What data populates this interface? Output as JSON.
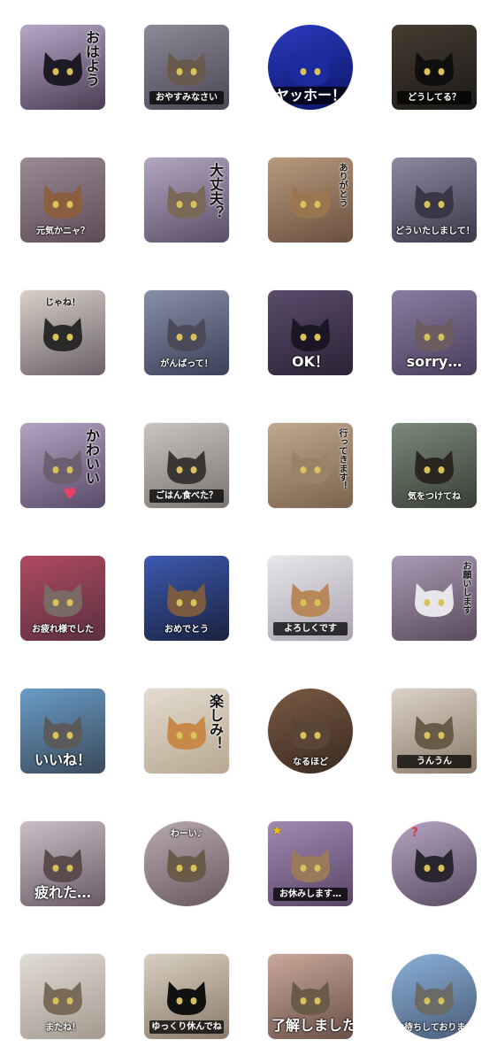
{
  "stickers": [
    {
      "id": "s01",
      "caption": "おはよう",
      "style": "vertical large black",
      "shape": "square",
      "bg": [
        "#b8a6c8",
        "#4a3d52"
      ],
      "cat": "#1d1a24",
      "deco": ""
    },
    {
      "id": "s02",
      "caption": "おやすみなさい",
      "style": "box",
      "shape": "square",
      "bg": [
        "#8b8a96",
        "#4c4654"
      ],
      "cat": "#6a5a4e",
      "deco": ""
    },
    {
      "id": "s03",
      "caption": "ヤッホー！",
      "style": "box big",
      "shape": "circle",
      "bg": [
        "#2a3bbf",
        "#0c1466"
      ],
      "cat": "#1b2a9c",
      "deco": ""
    },
    {
      "id": "s04",
      "caption": "どうしてる？",
      "style": "box",
      "shape": "square",
      "bg": [
        "#463c30",
        "#1b1a17"
      ],
      "cat": "#0f0f0f",
      "deco": ""
    },
    {
      "id": "s05",
      "caption": "元気かニャ？",
      "style": "white",
      "shape": "square",
      "bg": [
        "#9a8a94",
        "#5e4c56"
      ],
      "cat": "#8a5e3e",
      "deco": ""
    },
    {
      "id": "s06",
      "caption": "大丈夫？",
      "style": "vertical large black",
      "shape": "square",
      "bg": [
        "#b4a6c2",
        "#5a4e66"
      ],
      "cat": "#7a6858",
      "deco": ""
    },
    {
      "id": "s07",
      "caption": "ありがとう",
      "style": "vertical black",
      "shape": "square",
      "bg": [
        "#b89a7c",
        "#6a5040"
      ],
      "cat": "#9a7650",
      "deco": ""
    },
    {
      "id": "s08",
      "caption": "どういたしまして！",
      "style": "white",
      "shape": "square",
      "bg": [
        "#8c8aa2",
        "#3a3848"
      ],
      "cat": "#3a3646",
      "deco": ""
    },
    {
      "id": "s09",
      "caption": "じゃね！",
      "style": "black top",
      "shape": "square",
      "bg": [
        "#d8d0c8",
        "#6a6068"
      ],
      "cat": "#2a2a2a",
      "deco": ""
    },
    {
      "id": "s10",
      "caption": "がんばって！",
      "style": "white",
      "shape": "square",
      "bg": [
        "#8890a8",
        "#3a4056"
      ],
      "cat": "#4a4a5a",
      "deco": ""
    },
    {
      "id": "s11",
      "caption": "OK！",
      "style": "white big",
      "shape": "square",
      "bg": [
        "#5a4c6a",
        "#2a2236"
      ],
      "cat": "#1a1624",
      "deco": ""
    },
    {
      "id": "s12",
      "caption": "sorry…",
      "style": "white big",
      "shape": "square",
      "bg": [
        "#8a7ea0",
        "#4a3e5e"
      ],
      "cat": "#6a5c60",
      "deco": ""
    },
    {
      "id": "s13",
      "caption": "かわいい",
      "style": "vertical large black",
      "shape": "square",
      "bg": [
        "#b2a4c0",
        "#5a4a6a"
      ],
      "cat": "#6c6070",
      "deco": "heart"
    },
    {
      "id": "s14",
      "caption": "ごはん食べた？",
      "style": "box",
      "shape": "square",
      "bg": [
        "#c8c4c0",
        "#7a7470"
      ],
      "cat": "#3a3636",
      "deco": ""
    },
    {
      "id": "s15",
      "caption": "行ってきます！",
      "style": "vertical black",
      "shape": "square",
      "bg": [
        "#c0a88e",
        "#7a624e"
      ],
      "cat": "#9a8268",
      "deco": ""
    },
    {
      "id": "s16",
      "caption": "気をつけてね",
      "style": "white",
      "shape": "square",
      "bg": [
        "#7a8a7a",
        "#3a3e36"
      ],
      "cat": "#2a2622",
      "deco": ""
    },
    {
      "id": "s17",
      "caption": "お疲れ様でした",
      "style": "white",
      "shape": "square",
      "bg": [
        "#b04a60",
        "#5a3040"
      ],
      "cat": "#7a6a64",
      "deco": ""
    },
    {
      "id": "s18",
      "caption": "おめでとう",
      "style": "white",
      "shape": "square",
      "bg": [
        "#3c5ab0",
        "#1a2240"
      ],
      "cat": "#7a5a40",
      "deco": ""
    },
    {
      "id": "s19",
      "caption": "よろしくです",
      "style": "box",
      "shape": "square",
      "bg": [
        "#e8e6ea",
        "#a8a2ac"
      ],
      "cat": "#b8885a",
      "deco": ""
    },
    {
      "id": "s20",
      "caption": "お願いします",
      "style": "vertical black",
      "shape": "square",
      "bg": [
        "#a89ab4",
        "#5a4a5c"
      ],
      "cat": "#e8e6ea",
      "deco": ""
    },
    {
      "id": "s21",
      "caption": "いいね！",
      "style": "white big",
      "shape": "square",
      "bg": [
        "#6a9cc8",
        "#3a4a5a"
      ],
      "cat": "#5a5a5a",
      "deco": ""
    },
    {
      "id": "s22",
      "caption": "楽しみ！",
      "style": "vertical large black",
      "shape": "square",
      "bg": [
        "#e4dcd0",
        "#b8a890"
      ],
      "cat": "#c8884a",
      "deco": ""
    },
    {
      "id": "s23",
      "caption": "なるほど",
      "style": "white",
      "shape": "circle",
      "bg": [
        "#7a5a44",
        "#3a2a20"
      ],
      "cat": "#5a4636",
      "deco": ""
    },
    {
      "id": "s24",
      "caption": "うんうん",
      "style": "box",
      "shape": "square",
      "bg": [
        "#dcd2c8",
        "#8a7a6a"
      ],
      "cat": "#6a5a48",
      "deco": ""
    },
    {
      "id": "s25",
      "caption": "疲れた…",
      "style": "white big",
      "shape": "square",
      "bg": [
        "#c8c0c6",
        "#6a5a66"
      ],
      "cat": "#5a4c4c",
      "deco": ""
    },
    {
      "id": "s26",
      "caption": "わーい♪",
      "style": "white top",
      "shape": "oval",
      "bg": [
        "#b8aab0",
        "#6a5860"
      ],
      "cat": "#6a5a4a",
      "deco": ""
    },
    {
      "id": "s27",
      "caption": "お休みします…",
      "style": "box",
      "shape": "square",
      "bg": [
        "#a08ab2",
        "#5a4466"
      ],
      "cat": "#9a7a5a",
      "deco": "star"
    },
    {
      "id": "s28",
      "caption": "",
      "style": "white",
      "shape": "oval",
      "bg": [
        "#b4a4c2",
        "#5a4c62"
      ],
      "cat": "#2a2630",
      "deco": "question"
    },
    {
      "id": "s29",
      "caption": "またね！",
      "style": "white",
      "shape": "square",
      "bg": [
        "#e0dcd6",
        "#a49a8e"
      ],
      "cat": "#7a6a5a",
      "deco": ""
    },
    {
      "id": "s30",
      "caption": "ゆっくり休んでね",
      "style": "box",
      "shape": "square",
      "bg": [
        "#d8cfc0",
        "#8a7a6a"
      ],
      "cat": "#111111",
      "deco": ""
    },
    {
      "id": "s31",
      "caption": "了解しました",
      "style": "white big",
      "shape": "square",
      "bg": [
        "#caa89a",
        "#6a5048"
      ],
      "cat": "#6a5a48",
      "deco": ""
    },
    {
      "id": "s32",
      "caption": "お待ちしております",
      "style": "white",
      "shape": "circle",
      "bg": [
        "#8ab0d8",
        "#4a5c78"
      ],
      "cat": "#6a6a66",
      "deco": ""
    }
  ]
}
